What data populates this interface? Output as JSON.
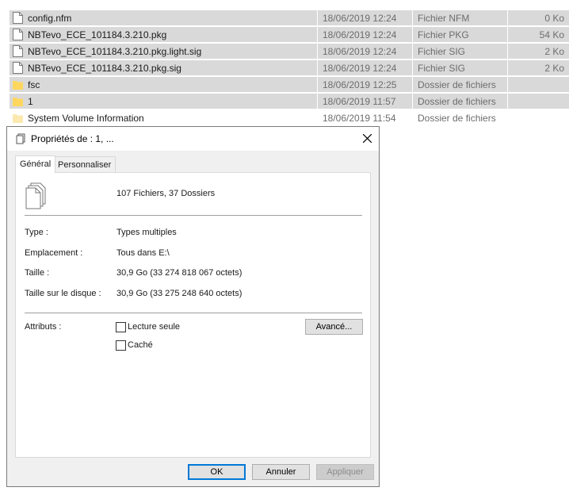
{
  "files": [
    {
      "name": "config.nfm",
      "date": "18/06/2019 12:24",
      "type": "Fichier NFM",
      "size": "0 Ko",
      "kind": "file",
      "selected": true
    },
    {
      "name": "NBTevo_ECE_101184.3.210.pkg",
      "date": "18/06/2019 12:24",
      "type": "Fichier PKG",
      "size": "54 Ko",
      "kind": "file",
      "selected": true
    },
    {
      "name": "NBTevo_ECE_101184.3.210.pkg.light.sig",
      "date": "18/06/2019 12:24",
      "type": "Fichier SIG",
      "size": "2 Ko",
      "kind": "file",
      "selected": true
    },
    {
      "name": "NBTevo_ECE_101184.3.210.pkg.sig",
      "date": "18/06/2019 12:24",
      "type": "Fichier SIG",
      "size": "2 Ko",
      "kind": "file",
      "selected": true
    },
    {
      "name": "fsc",
      "date": "18/06/2019 12:25",
      "type": "Dossier de fichiers",
      "size": "",
      "kind": "folder",
      "selected": true
    },
    {
      "name": "1",
      "date": "18/06/2019 11:57",
      "type": "Dossier de fichiers",
      "size": "",
      "kind": "folder",
      "selected": true
    },
    {
      "name": "System Volume Information",
      "date": "18/06/2019 11:54",
      "type": "Dossier de fichiers",
      "size": "",
      "kind": "folder-faded",
      "selected": false
    }
  ],
  "dialog": {
    "title": "Propriétés de : 1, ...",
    "tabs": {
      "general": "Général",
      "customize": "Personnaliser"
    },
    "summary": "107 Fichiers, 37 Dossiers",
    "labels": {
      "type": "Type :",
      "location": "Emplacement :",
      "size": "Taille :",
      "size_on_disk": "Taille sur le disque :",
      "attributes": "Attributs :"
    },
    "values": {
      "type": "Types multiples",
      "location": "Tous dans E:\\",
      "size": "30,9 Go (33 274 818 067 octets)",
      "size_on_disk": "30,9 Go (33 275 248 640 octets)"
    },
    "attributes": {
      "readonly": "Lecture seule",
      "hidden": "Caché",
      "readonly_checked": false,
      "hidden_checked": false
    },
    "buttons": {
      "advanced": "Avancé...",
      "ok": "OK",
      "cancel": "Annuler",
      "apply": "Appliquer"
    }
  },
  "colors": {
    "selection": "#d9d9d9",
    "folder": "#ffd75e",
    "accent": "#0078d7"
  }
}
